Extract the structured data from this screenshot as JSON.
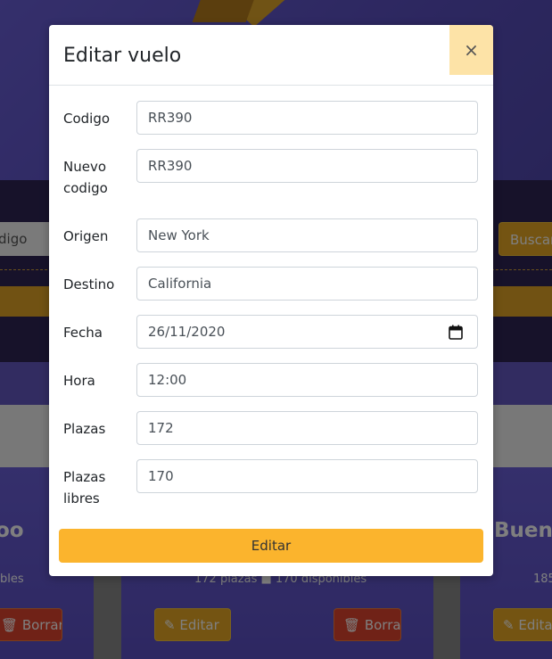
{
  "modal": {
    "title": "Editar vuelo",
    "close_label": "×",
    "submit_label": "Editar",
    "fields": {
      "codigo": {
        "label": "Codigo",
        "value": "RR390"
      },
      "nuevo_codigo": {
        "label": "Nuevo codigo",
        "value": "RR390"
      },
      "origen": {
        "label": "Origen",
        "value": "New York"
      },
      "destino": {
        "label": "Destino",
        "value": "California"
      },
      "fecha": {
        "label": "Fecha",
        "value": "26/11/2020"
      },
      "hora": {
        "label": "Hora",
        "value": "12:00"
      },
      "plazas": {
        "label": "Plazas",
        "value": "172"
      },
      "plazas_libres": {
        "label": "Plazas libres",
        "value": "170"
      }
    }
  },
  "background": {
    "search_placeholder": "digo",
    "search_button": "Buscar",
    "cards": [
      {
        "title": "oo",
        "subtitle": "bles",
        "delete_label": "Borrar"
      },
      {
        "subtitle": "172 plazas ■ 170 disponibles",
        "edit_label": "Editar",
        "delete_label": "Borrar"
      },
      {
        "title": "Bueno",
        "subtitle": "185",
        "edit_label": "Edita"
      }
    ]
  },
  "colors": {
    "accent": "#fbb42d",
    "close_bg": "#fde3a7",
    "danger": "#e0452f",
    "hero": "#5a4fc0"
  }
}
